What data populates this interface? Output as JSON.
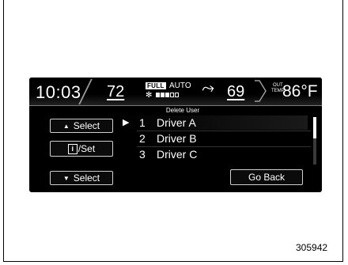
{
  "status": {
    "clock": "10:03",
    "driver_temp": "72",
    "fan_mode_badge": "FULL",
    "fan_mode": "AUTO",
    "fan_level": 0.4,
    "passenger_temp": "69",
    "out_temp_label_line1": "OUT",
    "out_temp_label_line2": "TEMP",
    "out_temp": "86°F"
  },
  "screen_title": "Delete User",
  "buttons": {
    "select_up": "Select",
    "set": "/Set",
    "set_icon_glyph": "i",
    "select_down": "Select",
    "go_back": "Go Back"
  },
  "users": [
    {
      "number": "1",
      "name": "Driver A",
      "selected": true
    },
    {
      "number": "2",
      "name": "Driver B",
      "selected": false
    },
    {
      "number": "3",
      "name": "Driver C",
      "selected": false
    }
  ],
  "scroll_fraction_visible": 0.45,
  "figure_id": "305942",
  "icons": {
    "up": "triangle-up-icon",
    "down": "triangle-down-icon",
    "info": "info-icon",
    "fan": "fan-icon",
    "airflow": "airflow-icon",
    "cursor": "cursor-triangle-icon"
  }
}
